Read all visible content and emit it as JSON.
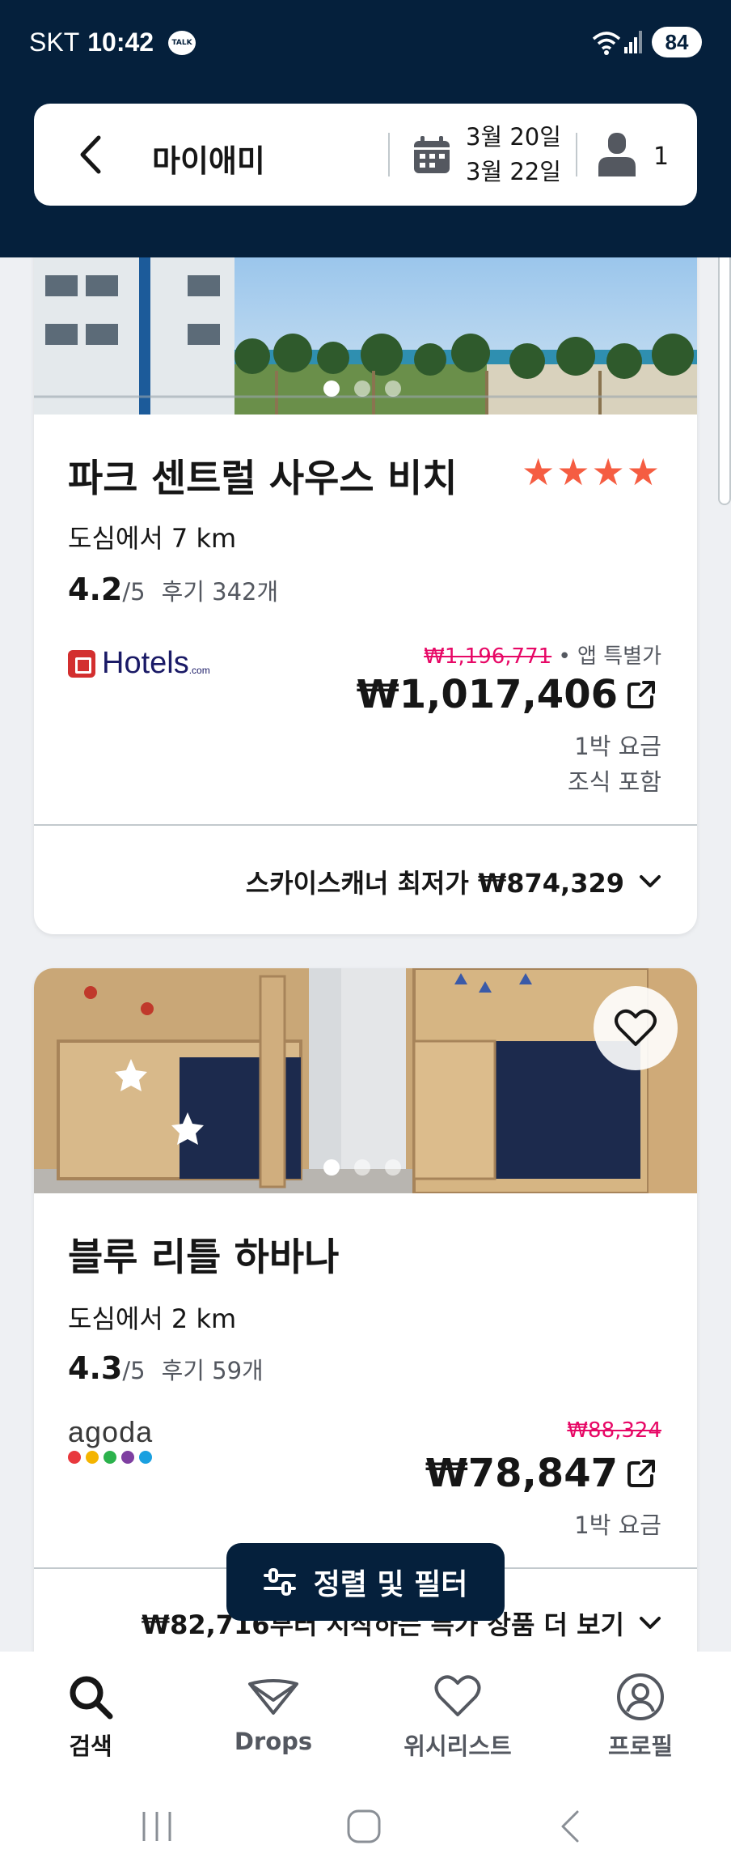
{
  "status_bar": {
    "carrier": "SKT",
    "time": "10:42",
    "talk_label": "TALK",
    "battery": "84"
  },
  "search": {
    "city": "마이애미",
    "checkin": "3월 20일",
    "checkout": "3월 22일",
    "guests": "1"
  },
  "hotels": [
    {
      "name": "파크 센트럴 사우스 비치",
      "stars": "★★★★",
      "distance": "도심에서 7 km",
      "score": "4.2",
      "score_max": "/5",
      "reviews": "후기 342개",
      "provider": "Hotels",
      "provider_suffix": ".com",
      "old_price": "₩1,196,771",
      "deal_label": " • 앱 특별가",
      "price": "₩1,017,406",
      "note1": "1박 요금",
      "note2": "조식 포함",
      "best_row": "스카이스캐너 최저가 ₩874,329"
    },
    {
      "name": "블루 리틀 하바나",
      "distance": "도심에서 2 km",
      "score": "4.3",
      "score_max": "/5",
      "reviews": "후기 59개",
      "provider": "agoda",
      "old_price": "₩88,324",
      "price": "₩78,847",
      "note1": "1박 요금",
      "best_row": "₩82,716부터 시작하는 특가 상품 더 보기"
    }
  ],
  "filter_button": "정렬 및 필터",
  "nav": {
    "search": "검색",
    "drops": "Drops",
    "wishlist": "위시리스트",
    "profile": "프로필"
  },
  "colors": {
    "header_bg": "#05203c",
    "star": "#f55d42",
    "strike_price": "#e70866",
    "agoda_dots": [
      "#e8383d",
      "#f4b400",
      "#2bb24c",
      "#7e3fa1",
      "#1aa0e0"
    ]
  }
}
